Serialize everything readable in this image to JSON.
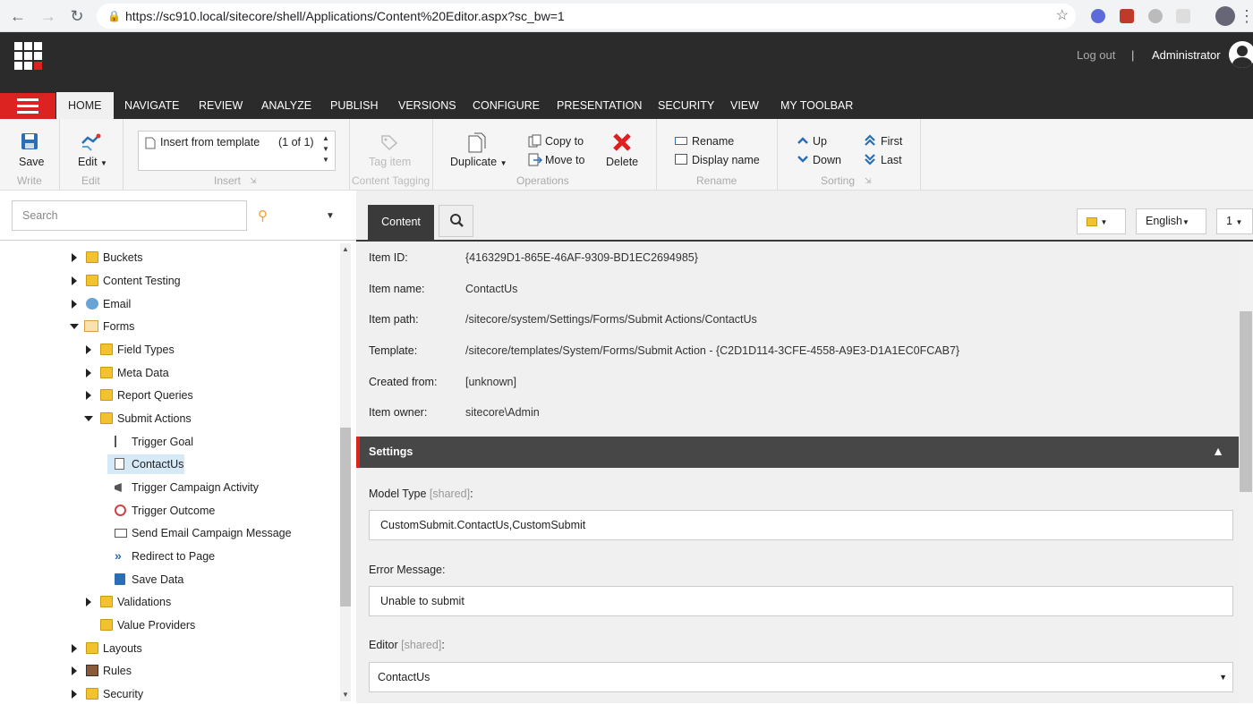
{
  "browser": {
    "url": "https://sc910.local/sitecore/shell/Applications/Content%20Editor.aspx?sc_bw=1"
  },
  "header": {
    "logout": "Log out",
    "separator": "|",
    "user": "Administrator"
  },
  "tabs": [
    "HOME",
    "NAVIGATE",
    "REVIEW",
    "ANALYZE",
    "PUBLISH",
    "VERSIONS",
    "CONFIGURE",
    "PRESENTATION",
    "SECURITY",
    "VIEW",
    "MY TOOLBAR"
  ],
  "ribbon": {
    "save": "Save",
    "write": "Write",
    "edit": "Edit",
    "edit_group": "Edit",
    "insert_item": "Insert from template",
    "insert_count": "(1 of 1)",
    "insert_group": "Insert",
    "tag_item": "Tag item",
    "content_tagging": "Content Tagging",
    "duplicate": "Duplicate",
    "copy_to": "Copy to",
    "move_to": "Move to",
    "delete": "Delete",
    "operations": "Operations",
    "rename": "Rename",
    "display_name": "Display name",
    "rename_group": "Rename",
    "up": "Up",
    "down": "Down",
    "first": "First",
    "last": "Last",
    "sorting": "Sorting"
  },
  "search": {
    "placeholder": "Search"
  },
  "tree": {
    "buckets": "Buckets",
    "content_testing": "Content Testing",
    "email": "Email",
    "forms": "Forms",
    "field_types": "Field Types",
    "meta_data": "Meta Data",
    "report_queries": "Report Queries",
    "submit_actions": "Submit Actions",
    "trigger_goal": "Trigger Goal",
    "contact_us": "ContactUs",
    "trigger_campaign": "Trigger Campaign Activity",
    "trigger_outcome": "Trigger Outcome",
    "send_email": "Send Email Campaign Message",
    "redirect": "Redirect to Page",
    "save_data": "Save Data",
    "validations": "Validations",
    "value_providers": "Value Providers",
    "layouts": "Layouts",
    "rules": "Rules",
    "security": "Security"
  },
  "content": {
    "tab": "Content",
    "language": "English",
    "version": "1",
    "item_id_label": "Item ID:",
    "item_id": "{416329D1-865E-46AF-9309-BD1EC2694985}",
    "item_name_label": "Item name:",
    "item_name": "ContactUs",
    "item_path_label": "Item path:",
    "item_path": "/sitecore/system/Settings/Forms/Submit Actions/ContactUs",
    "template_label": "Template:",
    "template": "/sitecore/templates/System/Forms/Submit Action - {C2D1D114-3CFE-4558-A9E3-D1A1EC0FCAB7}",
    "created_from_label": "Created from:",
    "created_from": "[unknown]",
    "item_owner_label": "Item owner:",
    "item_owner": "sitecore\\Admin",
    "settings": "Settings",
    "model_type_label": "Model Type",
    "shared": "[shared]",
    "colon": ":",
    "model_type": "CustomSubmit.ContactUs,CustomSubmit",
    "error_message_label": "Error Message:",
    "error_message": "Unable to submit",
    "editor_label": "Editor",
    "editor": "ContactUs"
  }
}
